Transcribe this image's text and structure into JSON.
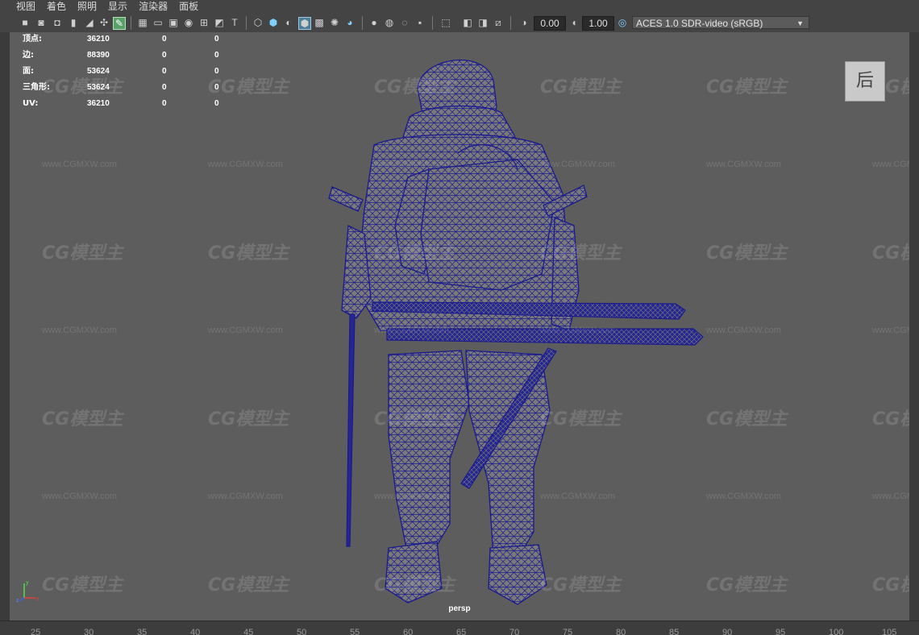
{
  "menu": [
    "视图",
    "着色",
    "照明",
    "显示",
    "渲染器",
    "面板"
  ],
  "toolbar": {
    "icons": [
      "camera-icon",
      "camera-lock-icon",
      "bookmark-icon",
      "image-plane-icon",
      "camera-attributes-icon",
      "pencil-icon",
      "grid-icon",
      "film-gate-icon",
      "resolution-gate-icon",
      "gate-mask-icon",
      "field-chart-icon",
      "safe-action-icon",
      "safe-title-icon",
      "wireframe-icon",
      "smooth-shade-icon",
      "shade-wireframe-icon",
      "default-material-icon",
      "textured-icon",
      "lights-icon",
      "shadows-icon",
      "ambient-occlusion-icon",
      "motion-blur-icon",
      "antialias-icon",
      "depth-of-field-icon",
      "isolate-select-icon",
      "xray-icon",
      "xray-joints-icon",
      "backface-icon",
      "exposure-icon",
      "gamma-icon",
      "color-management-icon"
    ],
    "exposure_value": "0.00",
    "gamma_value": "1.00",
    "color_space": "ACES 1.0 SDR-video (sRGB)"
  },
  "hud": {
    "rows": [
      {
        "label": "顶点:",
        "v1": "36210",
        "v2": "0",
        "v3": "0"
      },
      {
        "label": "边:",
        "v1": "88390",
        "v2": "0",
        "v3": "0"
      },
      {
        "label": "面:",
        "v1": "53624",
        "v2": "0",
        "v3": "0"
      },
      {
        "label": "三角形:",
        "v1": "53624",
        "v2": "0",
        "v3": "0"
      },
      {
        "label": "UV:",
        "v1": "36210",
        "v2": "0",
        "v3": "0"
      }
    ]
  },
  "viewcube_label": "后",
  "camera_name": "persp",
  "watermark": {
    "logo": "CG模型主",
    "url": "www.CGMXW.com"
  },
  "axis": {
    "x": "x",
    "y": "y",
    "z": "z"
  },
  "ruler": [
    "25",
    "30",
    "35",
    "40",
    "45",
    "50",
    "55",
    "60",
    "65",
    "70",
    "75",
    "80",
    "85",
    "90",
    "95",
    "100",
    "105"
  ],
  "colors": {
    "wire": "#1a1a8c",
    "mesh": "#7a7a7a",
    "viewport_bg": "#5d5d5d"
  }
}
